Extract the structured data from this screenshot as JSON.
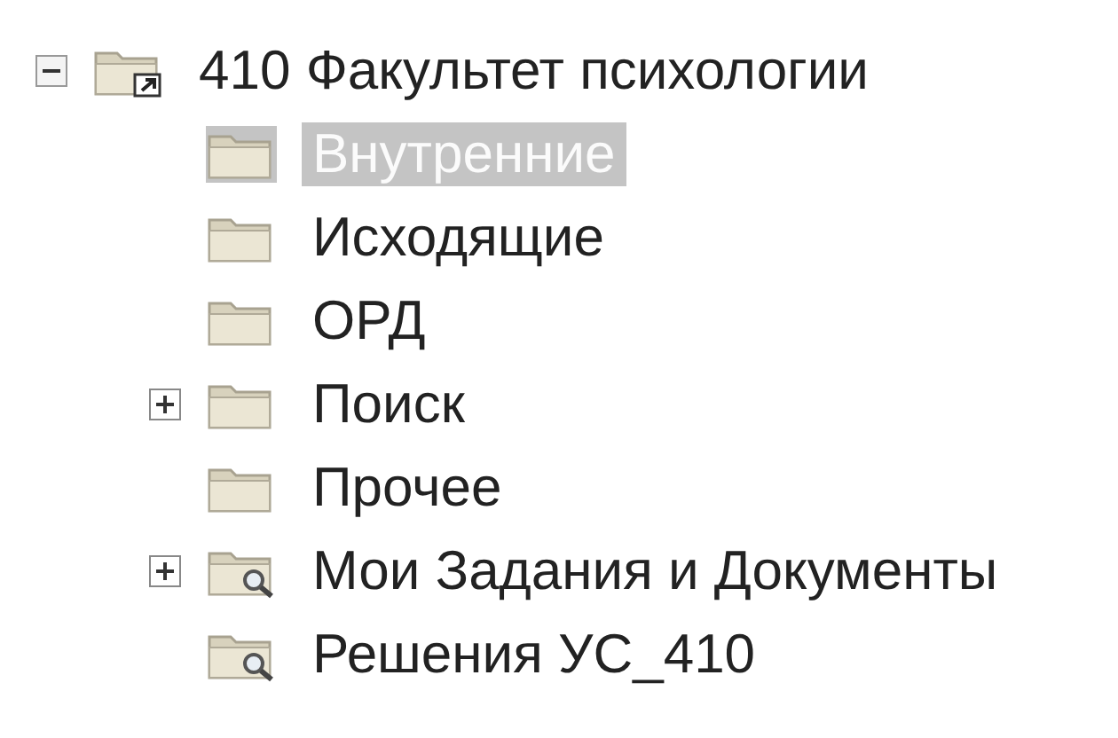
{
  "tree": {
    "label": "410 Факультет психологии",
    "kind": "shortcut-folder",
    "expanded": true,
    "selected": false,
    "children": [
      {
        "label": "Внутренние",
        "kind": "folder",
        "selected": true
      },
      {
        "label": "Исходящие",
        "kind": "folder",
        "selected": false
      },
      {
        "label": "ОРД",
        "kind": "folder",
        "selected": false
      },
      {
        "label": "Поиск",
        "kind": "folder",
        "expanded": false,
        "selected": false
      },
      {
        "label": "Прочее",
        "kind": "folder",
        "selected": false
      },
      {
        "label": "Мои Задания и Документы",
        "kind": "search-folder",
        "expanded": false,
        "selected": false
      },
      {
        "label": "Решения УС_410",
        "kind": "search-folder",
        "selected": false
      }
    ]
  }
}
